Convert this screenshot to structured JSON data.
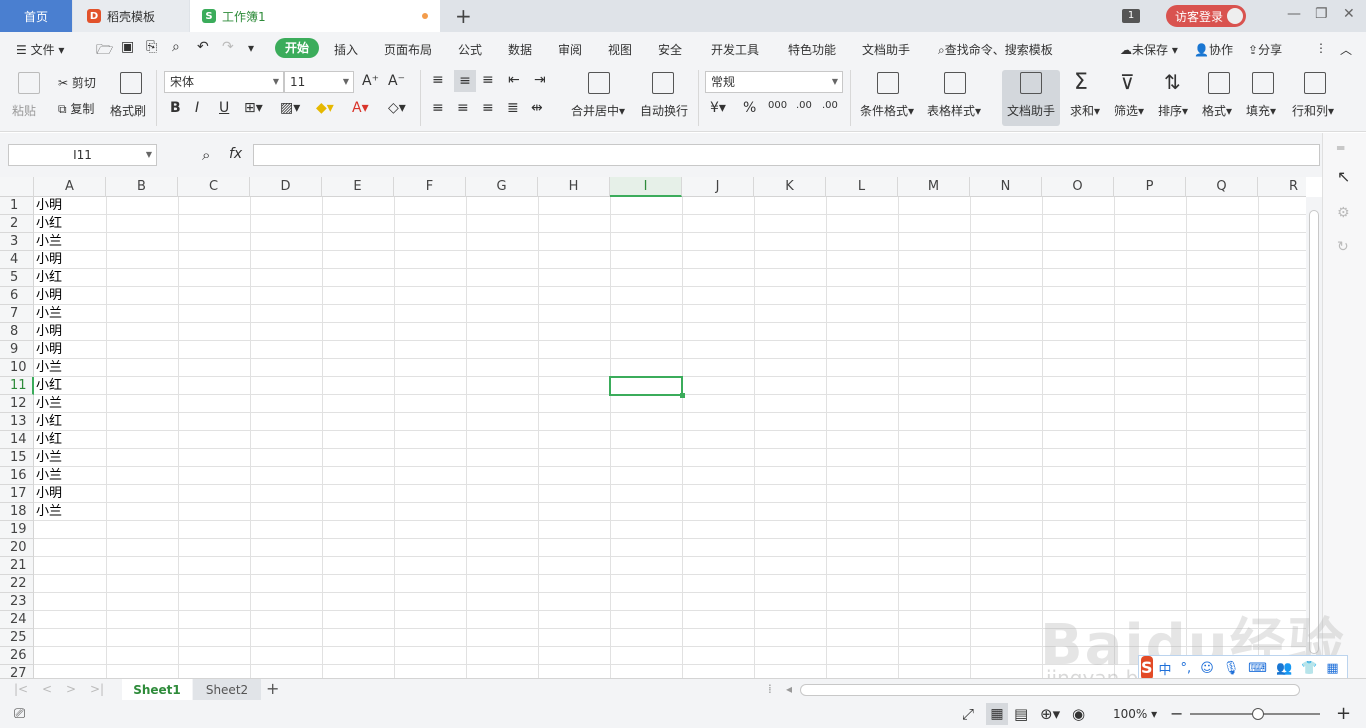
{
  "tabs": {
    "home": "首页",
    "template": "稻壳模板",
    "workbook": "工作簿1",
    "window_count": "1",
    "login": "访客登录"
  },
  "menu": {
    "file": "文件",
    "items": [
      "开始",
      "插入",
      "页面布局",
      "公式",
      "数据",
      "审阅",
      "视图",
      "安全",
      "开发工具",
      "特色功能",
      "文档助手"
    ],
    "search": "查找命令、搜索模板",
    "unsaved": "未保存",
    "collab": "协作",
    "share": "分享"
  },
  "ribbon": {
    "paste": "粘贴",
    "cut": "剪切",
    "copy": "复制",
    "format_painter": "格式刷",
    "font_name": "宋体",
    "font_size": "11",
    "merge_center": "合并居中",
    "wrap_text": "自动换行",
    "number_format": "常规",
    "conditional_format": "条件格式",
    "table_style": "表格样式",
    "doc_helper": "文档助手",
    "sum": "求和",
    "filter": "筛选",
    "sort": "排序",
    "format": "格式",
    "fill": "填充",
    "row_col": "行和列"
  },
  "formula_bar": {
    "cell_ref": "I11",
    "fx": "fx",
    "value": ""
  },
  "grid": {
    "columns": [
      "A",
      "B",
      "C",
      "D",
      "E",
      "F",
      "G",
      "H",
      "I",
      "J",
      "K",
      "L",
      "M",
      "N",
      "O",
      "P",
      "Q",
      "R"
    ],
    "selected_col": "I",
    "selected_row": 11,
    "rows": [
      "1",
      "2",
      "3",
      "4",
      "5",
      "6",
      "7",
      "8",
      "9",
      "10",
      "11",
      "12",
      "13",
      "14",
      "15",
      "16",
      "17",
      "18",
      "19",
      "20",
      "21",
      "22",
      "23",
      "24",
      "25",
      "26",
      "27"
    ],
    "col_a": [
      "小明",
      "小红",
      "小兰",
      "小明",
      "小红",
      "小明",
      "小兰",
      "小明",
      "小明",
      "小兰",
      "小红",
      "小兰",
      "小红",
      "小红",
      "小兰",
      "小兰",
      "小明",
      "小兰"
    ]
  },
  "sheets": [
    "Sheet1",
    "Sheet2"
  ],
  "status": {
    "zoom": "100%"
  },
  "ime": {
    "mode": "中",
    "punct": "°,"
  },
  "watermark": {
    "brand": "Baidu经验",
    "url": "jingyan.baidu.com"
  },
  "colors": {
    "accent": "#3bac5b",
    "home_tab": "#4a7fd0",
    "login": "#d9534f"
  }
}
